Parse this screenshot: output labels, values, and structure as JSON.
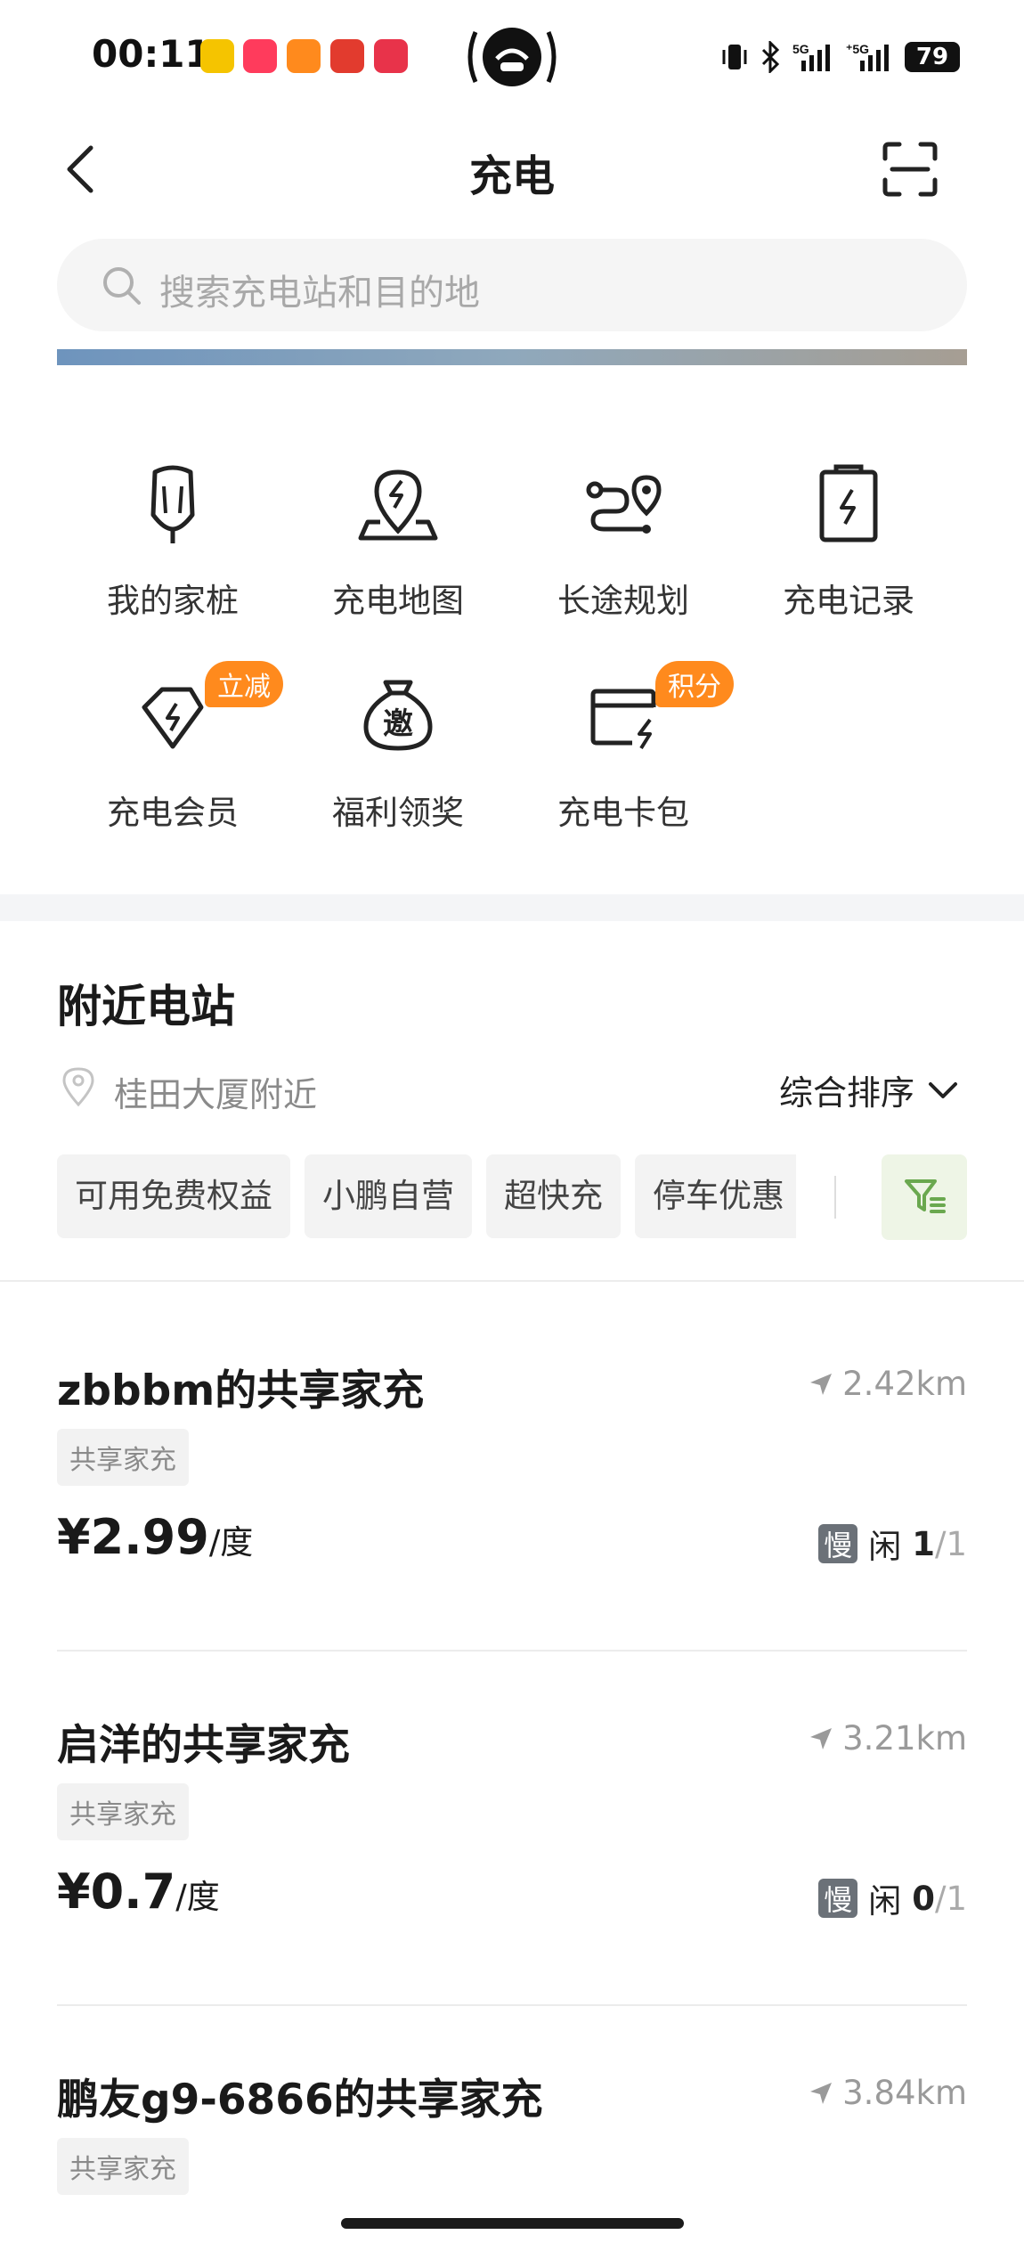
{
  "status_bar": {
    "time": "00:11",
    "battery": "79",
    "network": "5G"
  },
  "header": {
    "title": "充电"
  },
  "search": {
    "placeholder": "搜索充电站和目的地"
  },
  "quick_actions": [
    {
      "label": "我的家桩",
      "icon": "home-charger-icon"
    },
    {
      "label": "充电地图",
      "icon": "charging-map-icon"
    },
    {
      "label": "长途规划",
      "icon": "route-plan-icon"
    },
    {
      "label": "充电记录",
      "icon": "charging-record-icon"
    },
    {
      "label": "充电会员",
      "icon": "member-icon",
      "badge": "立减"
    },
    {
      "label": "福利领奖",
      "icon": "invite-bag-icon",
      "badge_text": "邀"
    },
    {
      "label": "充电卡包",
      "icon": "card-wallet-icon",
      "badge": "积分"
    }
  ],
  "nearby": {
    "title": "附近电站",
    "location": "桂田大厦附近",
    "sort_label": "综合排序",
    "chips": [
      "可用免费权益",
      "小鹏自营",
      "超快充",
      "停车优惠"
    ]
  },
  "stations": [
    {
      "name": "zbbbm的共享家充",
      "distance": "2.42km",
      "tag": "共享家充",
      "price": "¥2.99",
      "unit": "/度",
      "speed": "慢",
      "idle_label": "闲",
      "idle": "1",
      "total": "/1"
    },
    {
      "name": "启洋的共享家充",
      "distance": "3.21km",
      "tag": "共享家充",
      "price": "¥0.7",
      "unit": "/度",
      "speed": "慢",
      "idle_label": "闲",
      "idle": "0",
      "total": "/1"
    },
    {
      "name": "鹏友g9-6866的共享家充",
      "distance": "3.84km",
      "tag": "共享家充"
    }
  ],
  "colors": {
    "accent_orange": "#ff8a1d",
    "filter_green": "#6aa84f",
    "tag_gray": "#f2f2f2"
  }
}
